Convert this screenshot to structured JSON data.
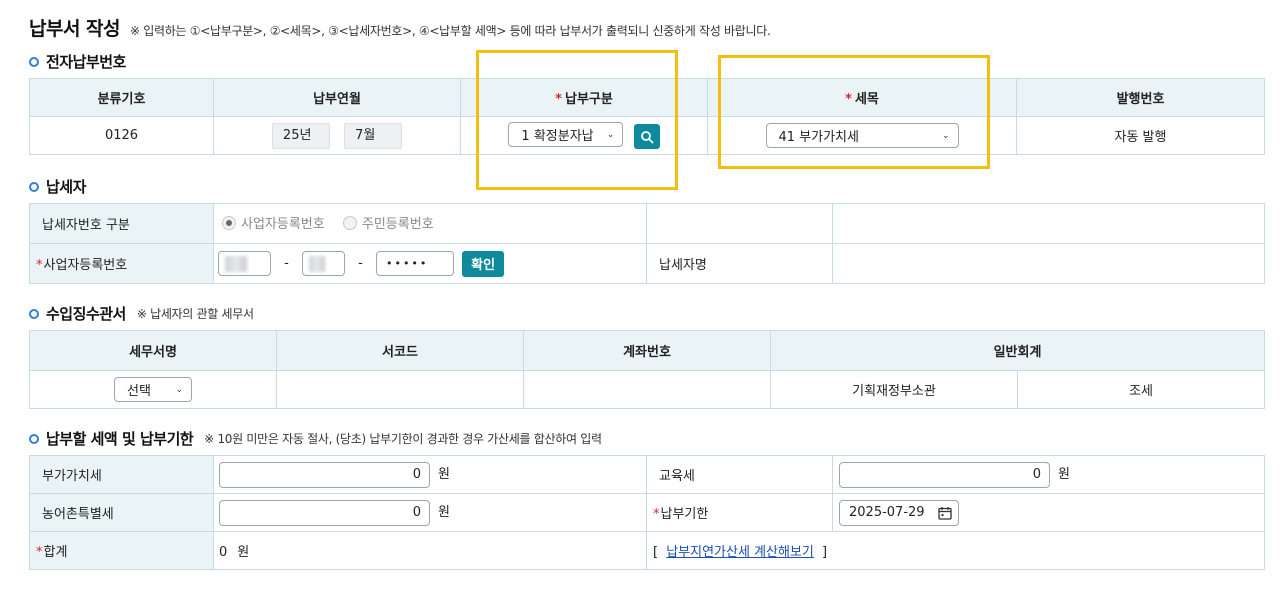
{
  "header": {
    "title": "납부서 작성",
    "note": "※ 입력하는 ①<납부구분>, ②<세목>, ③<납세자번호>, ④<납부할 세액> 등에 따라 납부서가 출력되니 신중하게 작성 바랍니다."
  },
  "electronic": {
    "title": "전자납부번호",
    "headers": {
      "category_code": "분류기호",
      "pay_year_month": "납부연월",
      "pay_type": "납부구분",
      "tax_item": "세목",
      "issue_no": "발행번호"
    },
    "category_code": "0126",
    "year": "25년",
    "month": "7월",
    "pay_type_value": "1 확정분자납",
    "tax_item_value": "41 부가가치세",
    "issue_no_value": "자동 발행"
  },
  "taxpayer": {
    "title": "납세자",
    "type_label": "납세자번호 구분",
    "radio_business": "사업자등록번호",
    "radio_resident": "주민등록번호",
    "biz_no_label": "사업자등록번호",
    "dash": "-",
    "masked": "•••••",
    "confirm": "확인",
    "name_label": "납세자명"
  },
  "office": {
    "title": "수입징수관서",
    "note": "※ 납세자의 관할 세무서",
    "headers": {
      "office_name": "세무서명",
      "office_code": "서코드",
      "account_no": "계좌번호",
      "general_account": "일반회계"
    },
    "select_value": "선택",
    "ministry": "기획재정부소관",
    "tax": "조세"
  },
  "amount": {
    "title": "납부할 세액 및 납부기한",
    "note": "※ 10원 미만은 자동 절사, (당초) 납부기한이 경과한 경우 가산세를 합산하여 입력",
    "vat_label": "부가가치세",
    "vat_value": "0",
    "edu_label": "교육세",
    "edu_value": "0",
    "rural_label": "농어촌특별세",
    "rural_value": "0",
    "deadline_label": "납부기한",
    "deadline_value": "2025-07-29",
    "total_label": "합계",
    "total_value": "0",
    "unit": "원",
    "bracket_open": "[",
    "bracket_close": "]",
    "late_link": "납부지연가산세 계산해보기"
  },
  "required_mark": "*",
  "colors": {
    "accent": "#0f8a9d",
    "header_bg": "#eaf4f6",
    "highlight": "#f5bd0f",
    "required": "#d3282f"
  }
}
